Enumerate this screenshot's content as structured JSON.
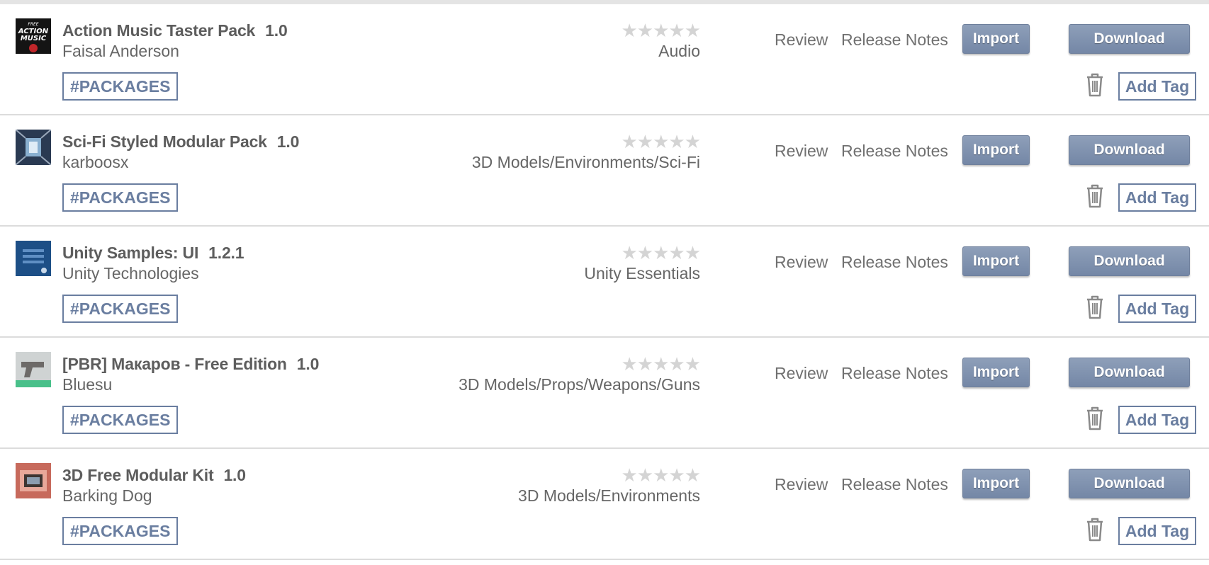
{
  "colors": {
    "accent": "#6a7ea0",
    "button_top": "#8e9fb9",
    "button_bottom": "#7487a6",
    "star_empty": "#d4d4d4",
    "divider": "#dcdcdc"
  },
  "labels": {
    "review": "Review",
    "release_notes": "Release Notes",
    "import": "Import",
    "download": "Download",
    "add_tag": "Add Tag",
    "stars": "★★★★★"
  },
  "packages": [
    {
      "title": "Action Music Taster Pack",
      "version": "1.0",
      "publisher": "Faisal Anderson",
      "category": "Audio",
      "tag": "#PACKAGES",
      "thumb_text": [
        "FREE",
        "ACTION",
        "MUSIC"
      ],
      "rating": 0
    },
    {
      "title": "Sci-Fi Styled Modular Pack",
      "version": "1.0",
      "publisher": "karboosx",
      "category": "3D Models/Environments/Sci-Fi",
      "tag": "#PACKAGES",
      "rating": 0
    },
    {
      "title": "Unity Samples: UI",
      "version": "1.2.1",
      "publisher": "Unity Technologies",
      "category": "Unity Essentials",
      "tag": "#PACKAGES",
      "rating": 0
    },
    {
      "title": "[PBR] Макаров - Free Edition",
      "version": "1.0",
      "publisher": "Bluesu",
      "category": "3D Models/Props/Weapons/Guns",
      "tag": "#PACKAGES",
      "rating": 0
    },
    {
      "title": "3D Free Modular Kit",
      "version": "1.0",
      "publisher": "Barking Dog",
      "category": "3D Models/Environments",
      "tag": "#PACKAGES",
      "rating": 0
    }
  ]
}
